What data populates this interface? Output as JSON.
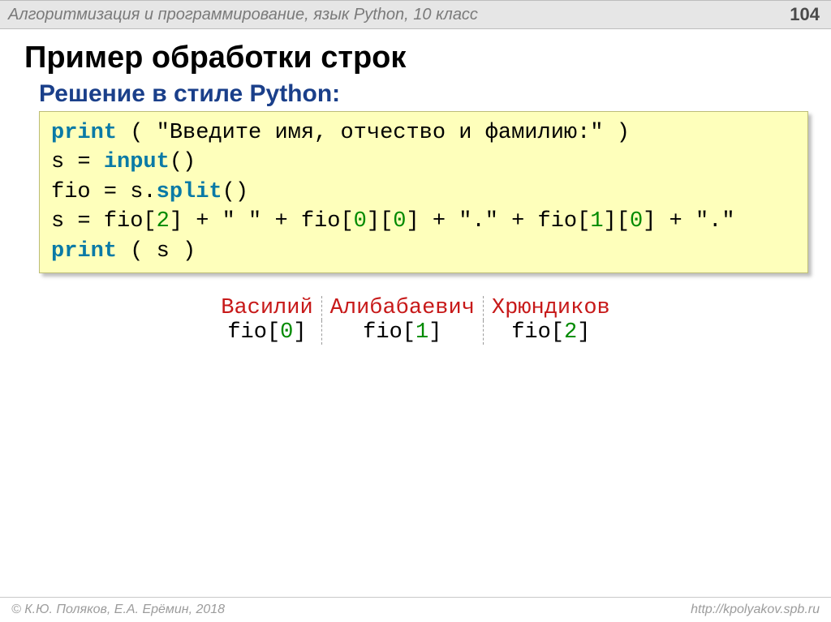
{
  "header": {
    "course": "Алгоритмизация и программирование, язык Python, 10 класс",
    "page": "104"
  },
  "title": "Пример обработки строк",
  "subtitle": "Решение в стиле Python:",
  "code": {
    "l1_kw": "print",
    "l1_open": " ( ",
    "l1_str": "\"Введите имя, отчество и фамилию:\"",
    "l1_close": " )",
    "l2_lhs": "s = ",
    "l2_kw": "input",
    "l2_tail": "()",
    "l3_lhs": "fio = s.",
    "l3_kw": "split",
    "l3_tail": "()",
    "l4_a": "s = fio[",
    "l4_n2": "2",
    "l4_b": "] + \" \" + fio[",
    "l4_n0a": "0",
    "l4_c": "][",
    "l4_n0b": "0",
    "l4_d": "] + \".\" + fio[",
    "l4_n1": "1",
    "l4_e": "][",
    "l4_n0c": "0",
    "l4_f": "] + \".\"",
    "l5_kw": "print",
    "l5_tail": " ( s )"
  },
  "diagram": {
    "names": [
      "Василий",
      "Алибабаевич",
      "Хрюндиков"
    ],
    "label_pre": "fio[",
    "label_post": "]",
    "idx0": "0",
    "idx1": "1",
    "idx2": "2"
  },
  "footer": {
    "left": "© К.Ю. Поляков, Е.А. Ерёмин, 2018",
    "right": "http://kpolyakov.spb.ru"
  }
}
